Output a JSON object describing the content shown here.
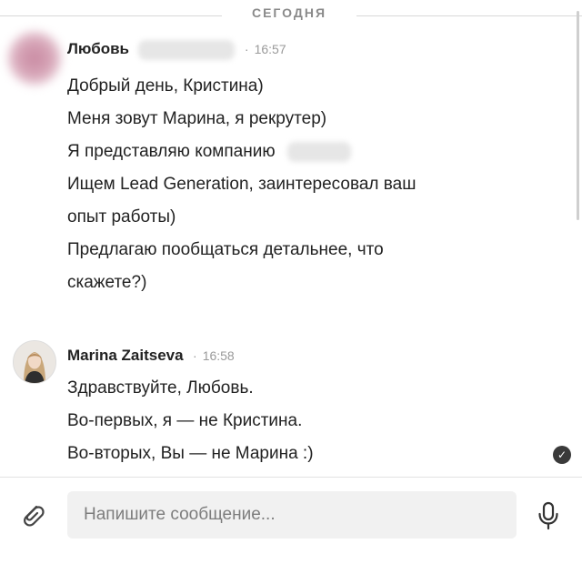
{
  "date_separator": "СЕГОДНЯ",
  "messages": [
    {
      "sender": "Любовь",
      "time": "16:57",
      "lines": [
        "Добрый день, Кристина)",
        "Меня зовут Марина, я рекрутер)",
        "Я представляю компанию",
        "Ищем Lead Generation, заинтересовал ваш",
        "опыт работы)",
        "Предлагаю пообщаться детальнее, что",
        "скажете?)"
      ]
    },
    {
      "sender": "Marina Zaitseva",
      "time": "16:58",
      "lines": [
        "Здравствуйте, Любовь.",
        "Во-первых, я — не Кристина.",
        "Во-вторых, Вы — не Марина :)"
      ]
    }
  ],
  "separator_dot": "·",
  "read_status_icon": "check-circle-icon",
  "compose": {
    "placeholder": "Напишите сообщение..."
  },
  "icons": {
    "attach": "paperclip-icon",
    "voice": "microphone-icon"
  }
}
